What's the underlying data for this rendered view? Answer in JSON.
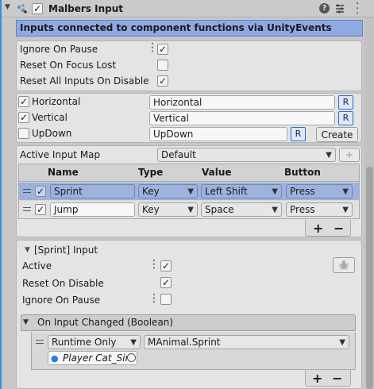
{
  "component": {
    "title": "Malbers Input",
    "expanded_arrow": "▼",
    "enabled_check": "✓",
    "icons": [
      "help-icon",
      "preset-icon",
      "more-vert-icon"
    ]
  },
  "banner": {
    "text": "Inputs connected to component functions via UnityEvents",
    "color": "#8fa9e3"
  },
  "settings": {
    "ignore_on_pause": {
      "label": "Ignore On Pause",
      "checked": "✓"
    },
    "reset_on_focus_lost": {
      "label": "Reset On Focus Lost",
      "checked": ""
    },
    "reset_all_inputs": {
      "label": "Reset All Inputs On Disable",
      "checked": "✓"
    }
  },
  "axes": [
    {
      "label": "Horizontal",
      "checked": "✓",
      "value": "Horizontal",
      "r": "R"
    },
    {
      "label": "Vertical",
      "checked": "✓",
      "value": "Vertical",
      "r": "R"
    },
    {
      "label": "UpDown",
      "checked": "",
      "value": "UpDown",
      "r": "R",
      "create": "Create"
    }
  ],
  "input_map": {
    "label": "Active Input Map",
    "selected": "Default",
    "add": "+",
    "columns": [
      "Name",
      "Type",
      "Value",
      "Button"
    ],
    "rows": [
      {
        "checked": "✓",
        "name": "Sprint",
        "type": "Key",
        "value": "Left Shift",
        "button": "Press",
        "selected": true
      },
      {
        "checked": "✓",
        "name": "Jump",
        "type": "Key",
        "value": "Space",
        "button": "Press",
        "selected": false
      }
    ],
    "plus": "+",
    "minus": "−"
  },
  "detail": {
    "title": "[Sprint] Input",
    "active": {
      "label": "Active",
      "checked": "✓"
    },
    "reset_on_disable": {
      "label": "Reset On Disable",
      "checked": "✓"
    },
    "ignore_on_pause": {
      "label": "Ignore On Pause",
      "checked": ""
    },
    "event": {
      "title": "On Input Changed (Boolean)",
      "runtime": "Runtime Only",
      "function": "MAnimal.Sprint",
      "target": "Player Cat_Sin",
      "plus": "+",
      "minus": "−"
    }
  },
  "dropdown_arrow": "▼"
}
